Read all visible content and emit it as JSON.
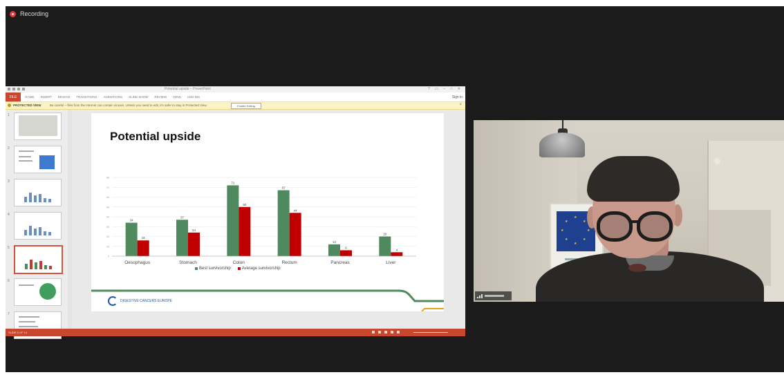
{
  "recording": {
    "label": "Recording"
  },
  "powerpoint": {
    "window_title": "Potential upside – PowerPoint",
    "file_tab": "FILE",
    "ribbon_tabs": [
      "HOME",
      "INSERT",
      "DESIGN",
      "TRANSITIONS",
      "ANIMATIONS",
      "SLIDE SHOW",
      "REVIEW",
      "VIEW",
      "ADD-INS"
    ],
    "protected_view": {
      "label": "PROTECTED VIEW",
      "message": "Be careful – files from the Internet can contain viruses. Unless you need to edit, it's safer to stay in Protected View.",
      "button": "Enable Editing"
    },
    "thumbnails": [
      {
        "number": "1",
        "active": false
      },
      {
        "number": "2",
        "active": false
      },
      {
        "number": "3",
        "active": false
      },
      {
        "number": "4",
        "active": false
      },
      {
        "number": "5",
        "active": true
      },
      {
        "number": "6",
        "active": false
      },
      {
        "number": "7",
        "active": false
      }
    ],
    "status_text": "SLIDE 5 OF 14"
  },
  "slide": {
    "title": "Potential upside",
    "logo_text": "DIGESTIVE CANCERS EUROPE"
  },
  "chart_data": {
    "type": "bar",
    "title": "",
    "categories": [
      "Oesophagus",
      "Stomach",
      "Colon",
      "Rectum",
      "Pancreas",
      "Liver"
    ],
    "series": [
      {
        "name": "Best survivorship",
        "color": "#4f8a5f",
        "values": [
          34,
          37,
          72,
          67,
          12,
          20
        ]
      },
      {
        "name": "Average survivorship",
        "color": "#c00000",
        "values": [
          16,
          24,
          50,
          44,
          6,
          4
        ]
      }
    ],
    "ylim": [
      0,
      80
    ],
    "grid": true,
    "legend_position": "bottom",
    "data_labels": true
  },
  "colors": {
    "ppt_accent": "#c9472f",
    "meeting_bg": "#1b1b1b",
    "slide_stripe": "#4f8a5f"
  }
}
